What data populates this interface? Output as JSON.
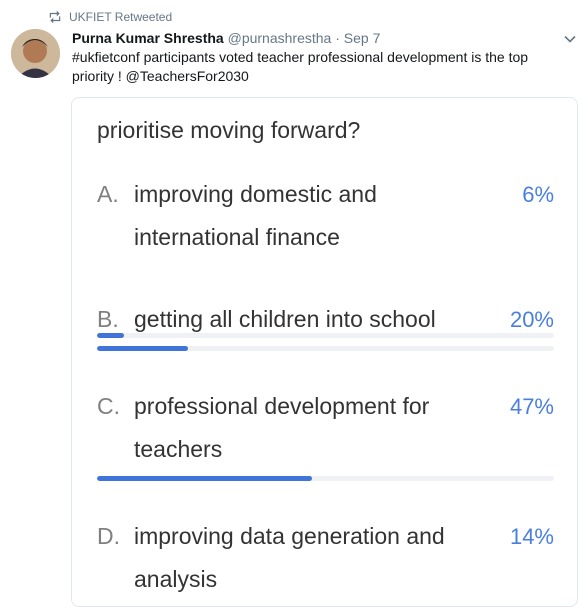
{
  "retweet": {
    "label": "UKFIET Retweeted"
  },
  "tweet": {
    "author_name": "Purna Kumar Shrestha",
    "author_handle": "@purnashrestha",
    "separator": "·",
    "date": "Sep 7",
    "text_line1": "#ukfietconf  participants voted teacher professional development is the top",
    "text_line2": "priority ! @TeachersFor2030"
  },
  "poll": {
    "question_line1": "",
    "question_line2": "prioritise moving forward?",
    "options": [
      {
        "letter": "A.",
        "text_line1": "improving domestic and",
        "text_line2": "international finance",
        "percent": "6%",
        "fill": 0.06
      },
      {
        "letter": "B.",
        "text_line1": "getting all children into school",
        "text_line2": "",
        "percent": "20%",
        "fill": 0.2
      },
      {
        "letter": "C.",
        "text_line1": "professional development for",
        "text_line2": "teachers",
        "percent": "47%",
        "fill": 0.47
      },
      {
        "letter": "D.",
        "text_line1": "improving data generation and",
        "text_line2": "analysis",
        "percent": "14%",
        "fill": 0.14
      }
    ]
  },
  "icons": {
    "retweet": "retweet-icon",
    "chevron": "chevron-down-icon",
    "avatar": "avatar"
  },
  "colors": {
    "accent": "#4a7fdd",
    "bar": "#3f74d8",
    "muted": "#657786"
  }
}
